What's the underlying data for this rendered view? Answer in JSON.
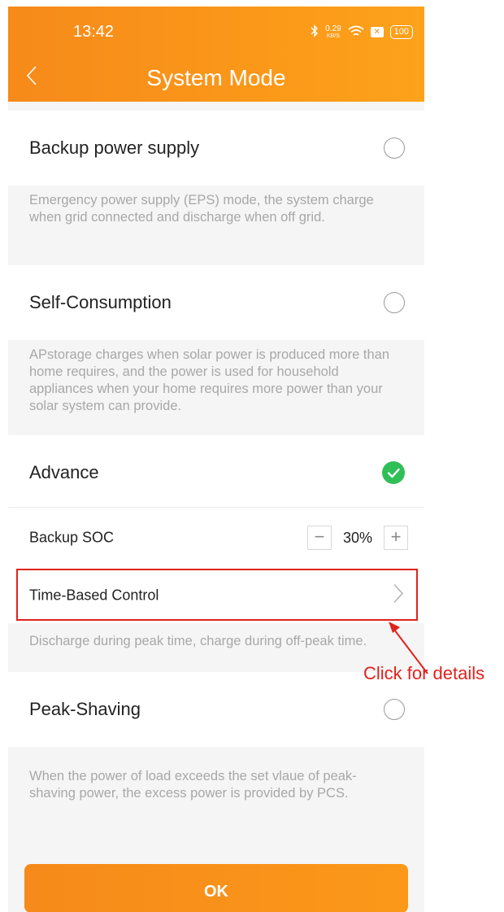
{
  "status_bar": {
    "time": "13:42",
    "net_speed_value": "0.29",
    "net_speed_unit": "KB/S",
    "battery": "100"
  },
  "header": {
    "title": "System Mode"
  },
  "modes": {
    "backup": {
      "label": "Backup power supply",
      "description": "Emergency power supply (EPS) mode, the system charge when grid connected and discharge when off grid.",
      "selected": false
    },
    "self_consumption": {
      "label": "Self-Consumption",
      "description": "APstorage charges when solar power is produced more than home requires, and the power is used for household appliances when your home requires more power than your solar system can provide.",
      "selected": false
    },
    "advance": {
      "label": "Advance",
      "selected": true,
      "backup_soc_label": "Backup SOC",
      "backup_soc_value": "30%",
      "time_based_label": "Time-Based Control",
      "description": "Discharge during peak time, charge during off-peak time."
    },
    "peak_shaving": {
      "label": "Peak-Shaving",
      "description": "When the power of load exceeds the set vlaue of peak-shaving power, the excess power is provided by PCS.",
      "selected": false
    }
  },
  "annotation": {
    "text": "Click for details"
  },
  "footer": {
    "ok_label": "OK"
  },
  "colors": {
    "accent": "#f68a1a",
    "selected": "#2fbf57",
    "annotation": "#e0231c"
  }
}
